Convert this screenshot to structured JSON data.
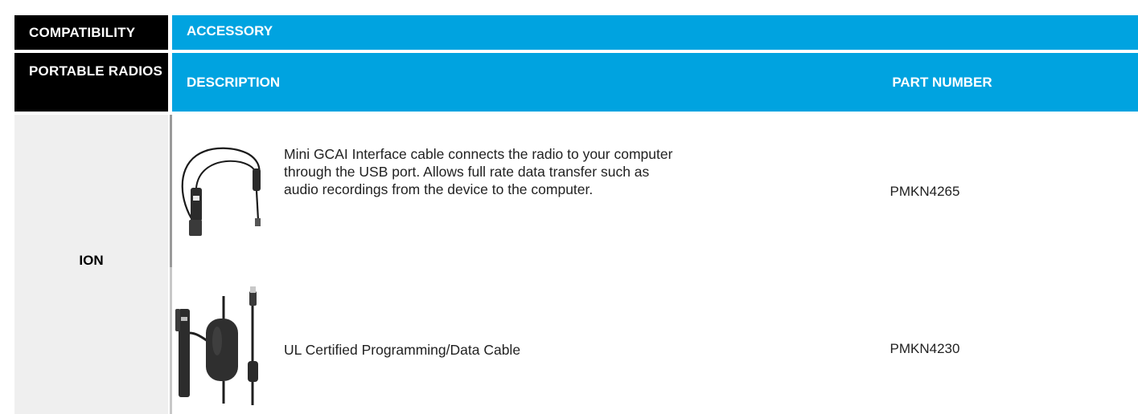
{
  "header": {
    "compatibility": "COMPATIBILITY",
    "accessory": "ACCESSORY",
    "portable_radios": "PORTABLE RADIOS",
    "description": "DESCRIPTION",
    "part_number": "PART NUMBER"
  },
  "colors": {
    "header_dark": "#000000",
    "header_blue": "#00a3e0",
    "left_cell_bg": "#efefef"
  },
  "group": {
    "label": "ION"
  },
  "rows": [
    {
      "icon": "interface-cable-image",
      "description": "Mini GCAI Interface cable connects the radio to your computer through the USB port. Allows full rate data transfer such as audio recordings from the device to the computer.",
      "part_number": "PMKN4265"
    },
    {
      "icon": "programming-cable-image",
      "description": "UL Certified Programming/Data Cable",
      "part_number": "PMKN4230"
    }
  ]
}
